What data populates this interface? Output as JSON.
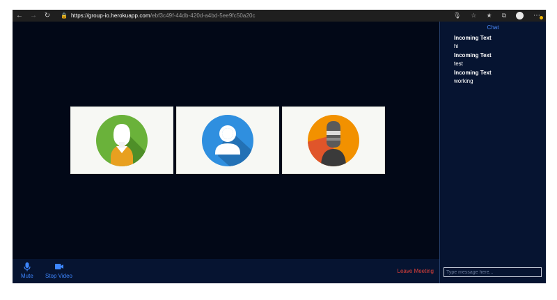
{
  "browser": {
    "url_host": "https://group-io.herokuapp.com",
    "url_path": "/ebf3c49f-44db-420d-a4bd-5ee9fc50a20c",
    "icons": [
      "back-icon",
      "forward-icon",
      "refresh-icon",
      "lock-icon",
      "mic-icon",
      "star-icon",
      "favorites-icon",
      "collections-icon",
      "profile-icon",
      "more-icon"
    ]
  },
  "participants": [
    {
      "name": "participant-1",
      "avatar": "woman-avatar"
    },
    {
      "name": "participant-2",
      "avatar": "user-avatar"
    },
    {
      "name": "participant-3",
      "avatar": "masked-avatar"
    }
  ],
  "controls": {
    "mute_label": "Mute",
    "stop_video_label": "Stop Video",
    "leave_label": "Leave Meeting"
  },
  "chat": {
    "title": "Chat",
    "messages": [
      {
        "from": "Incoming Text",
        "text": "hi"
      },
      {
        "from": "Incoming Text",
        "text": "test"
      },
      {
        "from": "Incoming Text",
        "text": "working"
      }
    ],
    "input_placeholder": "Type message here..."
  },
  "colors": {
    "meeting_bg": "#020817",
    "panel_bg": "#061431",
    "accent": "#3d86ff",
    "leave": "#e0413a"
  }
}
